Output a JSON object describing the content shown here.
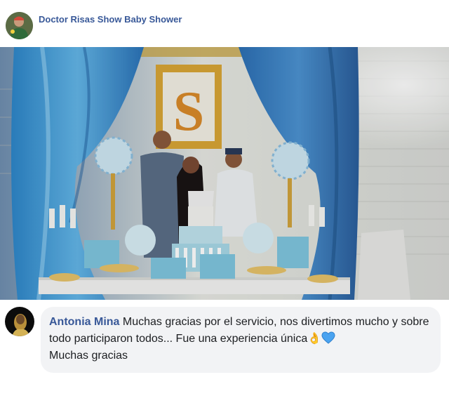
{
  "post": {
    "page_name": "Doctor Risas Show Baby Shower",
    "page_avatar_icon": "page-avatar-photo",
    "photo": {
      "description_icon": "baby-shower-party-photo",
      "frame_letter": "S"
    }
  },
  "comment": {
    "author": "Antonia Mina",
    "text_part1": " Muchas gracias por el servicio, nos divertimos mucho y sobre todo participaron todos... Fue una experiencia única",
    "emoji_ok": "👌",
    "emoji_heart_icon": "blue-heart-icon",
    "text_part2": "Muchas gracias"
  },
  "colors": {
    "link": "#385898",
    "bubble": "#f2f3f5",
    "text": "#1c1e21",
    "heart": "#4aa3f0"
  }
}
